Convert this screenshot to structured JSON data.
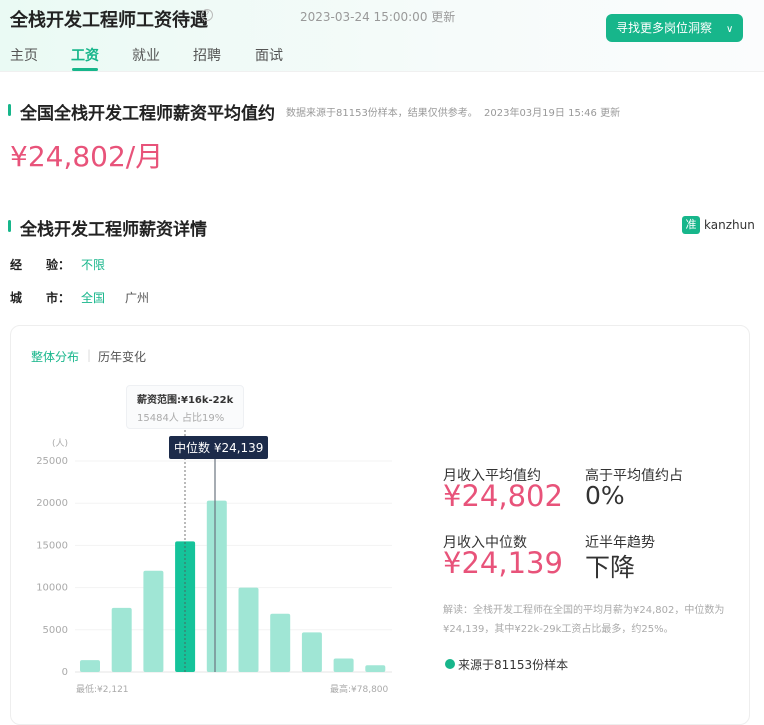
{
  "header": {
    "title": "全栈开发工程师工资待遇",
    "help_icon": "?",
    "updated": "2023-03-24 15:00:00 更新",
    "more_button": "寻找更多岗位洞察",
    "tabs": [
      "主页",
      "工资",
      "就业",
      "招聘",
      "面试"
    ],
    "active_tab": 1
  },
  "average": {
    "title": "全国全栈开发工程师薪资平均值约",
    "note": "数据来源于81153份样本，结果仅供参考。",
    "updated": "2023年03月19日 15:46 更新",
    "value": "¥24,802/月"
  },
  "detail": {
    "title": "全栈开发工程师薪资详情",
    "brand": "kanzhun",
    "brand_icon": "准",
    "experience_label": "经　　验：",
    "experience_value": "不限",
    "city_label": "城　　市：",
    "city_options": [
      "全国",
      "广州"
    ]
  },
  "card": {
    "tabs": [
      "整体分布",
      "历年变化"
    ],
    "tooltip_title": "薪资范围:¥16k-22k",
    "tooltip_sub": "15484人  占比19%",
    "median_tag": "中位数 ¥24,139",
    "min_label": "最低:¥2,121",
    "max_label": "最高:¥78,800",
    "stats": {
      "avg_label": "月收入平均值约",
      "avg_value": "¥24,802",
      "above_label": "高于平均值约占",
      "above_value": "0%",
      "median_label": "月收入中位数",
      "median_value": "¥24,139",
      "trend_label": "近半年趋势",
      "trend_value": "下降"
    },
    "interpretation": "解读：全栈开发工程师在全国的平均月薪为¥24,802，中位数为¥24,139，其中¥22k-29k工资占比最多，约25%。",
    "source": "来源于81153份样本"
  },
  "chart_data": {
    "type": "bar",
    "ylabel": "(人)",
    "ylim": [
      0,
      25000
    ],
    "yticks": [
      0,
      5000,
      10000,
      15000,
      20000,
      25000
    ],
    "values": [
      1400,
      7600,
      12000,
      15484,
      20300,
      10000,
      6900,
      4700,
      1600,
      800
    ],
    "highlight_index": 3,
    "median_position": 4.0,
    "colors": {
      "bar": "#a0e6d5",
      "highlight": "#15c39a"
    }
  }
}
